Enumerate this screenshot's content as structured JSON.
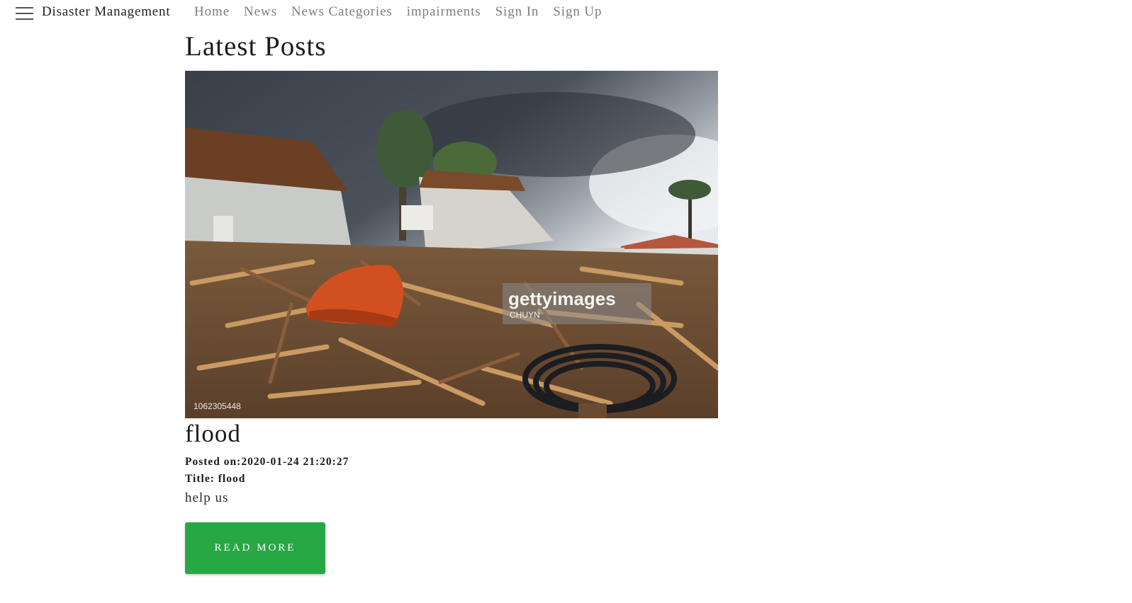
{
  "nav": {
    "brand": "Disaster Management",
    "links": [
      "Home",
      "News",
      "News Categories",
      "impairments",
      "Sign In",
      "Sign Up"
    ]
  },
  "main": {
    "heading": "Latest Posts"
  },
  "post": {
    "image_watermark": "gettyimages",
    "image_credit": "CHUYN",
    "image_id": "1062305448",
    "title": "flood",
    "posted_on": "Posted on:2020-01-24 21:20:27",
    "title_line": "Title: flood",
    "excerpt": "help us",
    "read_more_label": "READ MORE"
  },
  "colors": {
    "button": "#28a745",
    "nav_link": "#7d7d7d"
  }
}
